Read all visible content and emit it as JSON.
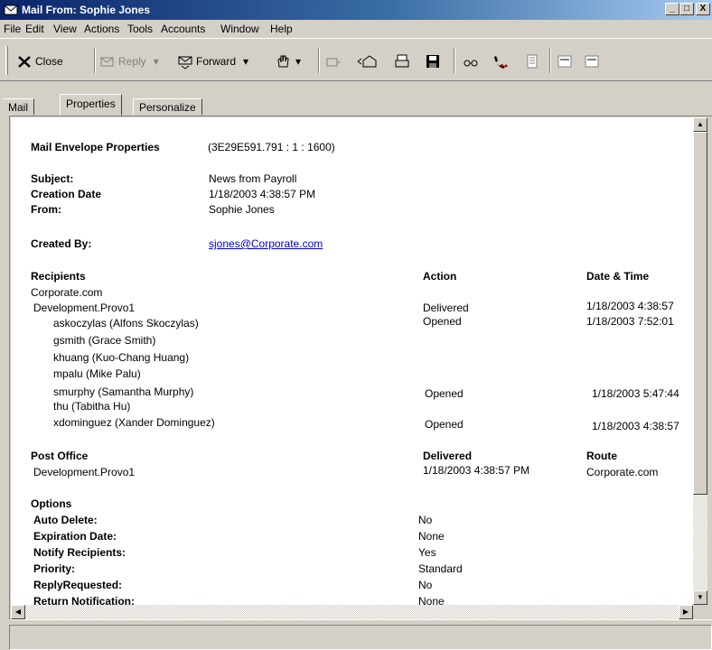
{
  "window": {
    "title": "Mail From: Sophie Jones",
    "minimize": "_",
    "maximize": "□",
    "close": "X"
  },
  "menu": [
    "File",
    "Edit",
    "View",
    "Actions",
    "Tools",
    "Accounts",
    "Window",
    "Help"
  ],
  "toolbar": {
    "close": "Close",
    "reply": "Reply",
    "forward": "Forward"
  },
  "tabs": [
    "Mail",
    "Properties",
    "Personalize"
  ],
  "envelope": {
    "heading": "Mail Envelope Properties",
    "id": "(3E29E591.791 : 1 : 1600)",
    "subject_label": "Subject:",
    "subject": "News from Payroll",
    "creation_label": "Creation Date",
    "creation": "1/18/2003 4:38:57 PM",
    "from_label": "From:",
    "from": "Sophie Jones",
    "created_by_label": "Created By:",
    "created_by": "sjones@Corporate.com"
  },
  "recipients": {
    "headers": {
      "recipients": "Recipients",
      "action": "Action",
      "datetime": "Date & Time"
    },
    "rows": [
      {
        "name": "Corporate.com",
        "action": "",
        "datetime": ""
      },
      {
        "name": "Development.Provo1",
        "action": "Delivered",
        "datetime": "1/18/2003 4:38:57"
      },
      {
        "name": "askoczylas (Alfons Skoczylas)",
        "action": "Opened",
        "datetime": "1/18/2003 7:52:01"
      },
      {
        "name": "gsmith (Grace Smith)",
        "action": "",
        "datetime": ""
      },
      {
        "name": "khuang (Kuo-Chang Huang)",
        "action": "",
        "datetime": ""
      },
      {
        "name": "mpalu (Mike Palu)",
        "action": "",
        "datetime": ""
      },
      {
        "name": "smurphy (Samantha Murphy)",
        "action": "Opened",
        "datetime": "1/18/2003 5:47:44"
      },
      {
        "name": "thu (Tabitha Hu)",
        "action": "",
        "datetime": ""
      },
      {
        "name": "xdominguez (Xander Dominguez)",
        "action": "Opened",
        "datetime": "1/18/2003 4:38:57"
      }
    ]
  },
  "postoffice": {
    "headers": {
      "po": "Post Office",
      "delivered": "Delivered",
      "route": "Route"
    },
    "po": "Development.Provo1",
    "delivered": "1/18/2003 4:38:57 PM",
    "route": "Corporate.com"
  },
  "options": {
    "heading": "Options",
    "rows": [
      {
        "label": "Auto Delete:",
        "value": "No"
      },
      {
        "label": "Expiration Date:",
        "value": "None"
      },
      {
        "label": "Notify Recipients:",
        "value": "Yes"
      },
      {
        "label": "Priority:",
        "value": "Standard"
      },
      {
        "label": "ReplyRequested:",
        "value": "No"
      },
      {
        "label": "Return Notification:",
        "value": "None"
      }
    ]
  }
}
